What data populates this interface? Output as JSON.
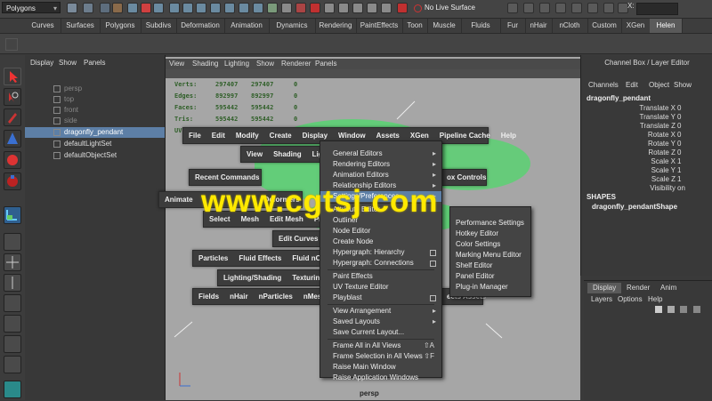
{
  "top": {
    "menuset": "Polygons",
    "live_surface": "No Live Surface",
    "x_label": "X:"
  },
  "shelf_tabs": [
    "Curves",
    "Surfaces",
    "Polygons",
    "Subdivs",
    "Deformation",
    "Animation",
    "Dynamics",
    "Rendering",
    "PaintEffects",
    "Toon",
    "Muscle",
    "Fluids",
    "Fur",
    "nHair",
    "nCloth",
    "Custom",
    "XGen",
    "Helen"
  ],
  "shelf_active": "Helen",
  "outliner": {
    "menu": [
      "Display",
      "Show",
      "Panels"
    ],
    "items": [
      {
        "label": "persp",
        "camera": true,
        "selected": false
      },
      {
        "label": "top",
        "camera": true,
        "selected": false
      },
      {
        "label": "front",
        "camera": true,
        "selected": false
      },
      {
        "label": "side",
        "camera": true,
        "selected": false
      },
      {
        "label": "dragonfly_pendant",
        "camera": false,
        "selected": true
      },
      {
        "label": "defaultLightSet",
        "camera": false,
        "selected": false
      },
      {
        "label": "defaultObjectSet",
        "camera": false,
        "selected": false
      }
    ]
  },
  "viewport": {
    "menu": [
      "View",
      "Shading",
      "Lighting",
      "Show",
      "Renderer",
      "Panels"
    ],
    "hud": [
      {
        "label": "Verts:",
        "a": "297407",
        "b": "297407",
        "c": "0"
      },
      {
        "label": "Edges:",
        "a": "892997",
        "b": "892997",
        "c": "0"
      },
      {
        "label": "Faces:",
        "a": "595442",
        "b": "595442",
        "c": "0"
      },
      {
        "label": "Tris:",
        "a": "595442",
        "b": "595442",
        "c": "0"
      },
      {
        "label": "UVs:",
        "a": "",
        "b": "",
        "c": ""
      }
    ],
    "camera_label": "persp"
  },
  "hotbox": {
    "row1": [
      "File",
      "Edit",
      "Modify",
      "Create",
      "Display",
      "Window",
      "Assets",
      "XGen",
      "Pipeline Cache",
      "Help"
    ],
    "row2": [
      "View",
      "Shading",
      "Ligh"
    ],
    "recent": "Recent Commands",
    "box_controls": "ox Controls",
    "animate": "Animate",
    "row3": [
      "Select",
      "Mesh",
      "Edit Mesh",
      "Prox"
    ],
    "edit_curves": "Edit Curves",
    "row4": [
      "Particles",
      "Fluid Effects",
      "Fluid nCach"
    ],
    "row5": [
      "Lighting/Shading",
      "Texturing"
    ],
    "row6": [
      "Fields",
      "nHair",
      "nParticles",
      "nMesh"
    ],
    "fragments": [
      "Deformers",
      "ects Assets"
    ]
  },
  "window_menu": {
    "items": [
      {
        "label": "General Editors",
        "arrow": true
      },
      {
        "label": "Rendering Editors",
        "arrow": true
      },
      {
        "label": "Animation Editors",
        "arrow": true
      },
      {
        "label": "Relationship Editors",
        "arrow": true
      },
      {
        "label": "Settings/Preferences",
        "arrow": true,
        "highlight": true
      },
      {
        "label": "Attribute Editor"
      },
      {
        "label": "Outliner"
      },
      {
        "label": "Node Editor"
      },
      {
        "label": "Create Node"
      },
      {
        "label": "Hypergraph: Hierarchy",
        "check": true
      },
      {
        "label": "Hypergraph: Connections",
        "check": true
      },
      {
        "label": "Paint Effects"
      },
      {
        "label": "UV Texture Editor"
      },
      {
        "label": "Playblast",
        "check": true
      },
      {
        "label": "View Arrangement",
        "arrow": true
      },
      {
        "label": "Saved Layouts",
        "arrow": true
      },
      {
        "label": "Save Current Layout..."
      },
      {
        "label": "Frame All in All Views",
        "shortcut": "⇧A"
      },
      {
        "label": "Frame Selection in All Views",
        "shortcut": "⇧F"
      },
      {
        "label": "Raise Main Window"
      },
      {
        "label": "Raise Application Windows"
      }
    ]
  },
  "settings_submenu": [
    "Performance Settings",
    "Hotkey Editor",
    "Color Settings",
    "Marking Menu Editor",
    "Shelf Editor",
    "Panel Editor",
    "Plug-in Manager"
  ],
  "watermark": "www.cgtsj.com",
  "channel_box": {
    "title": "Channel Box / Layer Editor",
    "menu": [
      "Channels",
      "Edit",
      "Object",
      "Show"
    ],
    "object": "dragonfly_pendant",
    "attrs": [
      {
        "k": "Translate X",
        "v": "0"
      },
      {
        "k": "Translate Y",
        "v": "0"
      },
      {
        "k": "Translate Z",
        "v": "0"
      },
      {
        "k": "Rotate X",
        "v": "0"
      },
      {
        "k": "Rotate Y",
        "v": "0"
      },
      {
        "k": "Rotate Z",
        "v": "0"
      },
      {
        "k": "Scale X",
        "v": "1"
      },
      {
        "k": "Scale Y",
        "v": "1"
      },
      {
        "k": "Scale Z",
        "v": "1"
      },
      {
        "k": "Visibility",
        "v": "on"
      }
    ],
    "shapes_header": "SHAPES",
    "shape": "dragonfly_pendantShape"
  },
  "layer_editor": {
    "tabs": [
      "Display",
      "Render",
      "Anim"
    ],
    "menu": [
      "Layers",
      "Options",
      "Help"
    ]
  },
  "colors": {
    "selection": "#5d7fa6",
    "mesh_green": "#5fcf76",
    "watermark": "#ffe900"
  }
}
